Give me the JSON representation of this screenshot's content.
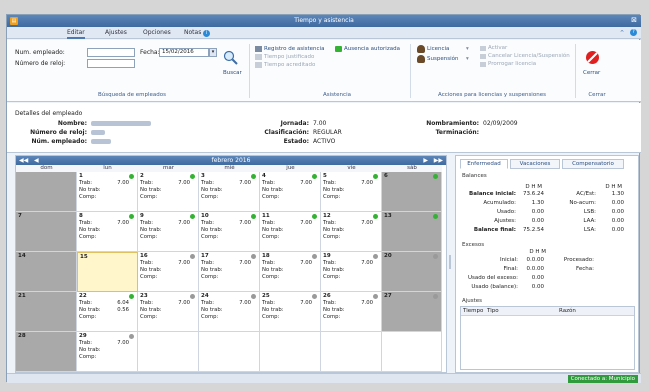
{
  "window": {
    "title": "Tiempo y asistencia",
    "app_icon_glyph": "▤"
  },
  "tabs": [
    "Editar",
    "Ajustes",
    "Opciones",
    "Notas"
  ],
  "search": {
    "emp_label": "Num. empleado:",
    "clock_label": "Número de reloj:",
    "date_label": "Fecha:",
    "date_value": "15/02/2016",
    "button": "Buscar",
    "group": "Búsqueda de empleados"
  },
  "asistencia": {
    "registro": "Registro de asistencia",
    "ausencia": "Ausencia autorizada",
    "justificado": "Tiempo justificado",
    "acreditado": "Tiempo acreditado",
    "group": "Asistencia"
  },
  "licencias": {
    "licencia": "Licencia",
    "suspension": "Suspensión",
    "activar": "Activar",
    "cancelar": "Cancelar Licencia/Suspensión",
    "prorrogar": "Prorrogar licencia",
    "group": "Acciones para licencias y suspensiones"
  },
  "cerrar": {
    "button": "Cerrar",
    "group": "Cerrar"
  },
  "details": {
    "heading": "Detalles del empleado",
    "nombre_label": "Nombre:",
    "reloj_label": "Número de reloj:",
    "num_label": "Núm. empleado:",
    "jornada_label": "Jornada:",
    "jornada_value": "7.00",
    "clasif_label": "Clasificación:",
    "clasif_value": "REGULAR",
    "estado_label": "Estado:",
    "estado_value": "ACTIVO",
    "nombram_label": "Nombramiento:",
    "nombram_value": "02/09/2009",
    "termin_label": "Terminación:",
    "termin_value": ""
  },
  "calendar": {
    "month": "febrero 2016",
    "nav_prev2": "◀◀",
    "nav_prev": "◀",
    "nav_next": "▶",
    "nav_next2": "▶▶",
    "days": [
      "dom",
      "lun",
      "mar",
      "mié",
      "jue",
      "vie",
      "sáb"
    ],
    "labels": {
      "trab": "Trab:",
      "notrab": "No trab:",
      "comp": "Comp:"
    },
    "weeks": [
      [
        {
          "d": "",
          "gray": true
        },
        {
          "d": "1",
          "trab": "7.00",
          "notrab": "",
          "dot": "#34b233"
        },
        {
          "d": "2",
          "trab": "7.00",
          "notrab": "",
          "dot": "#34b233"
        },
        {
          "d": "3",
          "trab": "7.00",
          "notrab": "",
          "dot": "#34b233"
        },
        {
          "d": "4",
          "trab": "7.00",
          "notrab": "",
          "dot": "#34b233"
        },
        {
          "d": "5",
          "trab": "7.00",
          "notrab": "",
          "dot": "#34b233"
        },
        {
          "d": "6",
          "gray": true,
          "dot": "#34b233"
        }
      ],
      [
        {
          "d": "7",
          "gray": true
        },
        {
          "d": "8",
          "trab": "7.00",
          "notrab": "",
          "dot": "#34b233"
        },
        {
          "d": "9",
          "trab": "7.00",
          "notrab": "",
          "dot": "#34b233"
        },
        {
          "d": "10",
          "trab": "7.00",
          "notrab": "",
          "dot": "#34b233"
        },
        {
          "d": "11",
          "trab": "7.00",
          "notrab": "",
          "dot": "#34b233"
        },
        {
          "d": "12",
          "trab": "7.00",
          "notrab": "",
          "dot": "#34b233"
        },
        {
          "d": "13",
          "gray": true,
          "dot": "#34b233"
        }
      ],
      [
        {
          "d": "14",
          "gray": true
        },
        {
          "d": "15",
          "today": true
        },
        {
          "d": "16",
          "trab": "7.00",
          "notrab": "",
          "dot": "#9a9a9a"
        },
        {
          "d": "17",
          "trab": "7.00",
          "notrab": "",
          "dot": "#9a9a9a"
        },
        {
          "d": "18",
          "trab": "7.00",
          "notrab": "",
          "dot": "#9a9a9a"
        },
        {
          "d": "19",
          "trab": "7.00",
          "notrab": "",
          "dot": "#9a9a9a"
        },
        {
          "d": "20",
          "gray": true,
          "dot": "#9a9a9a"
        }
      ],
      [
        {
          "d": "21",
          "gray": true
        },
        {
          "d": "22",
          "trab": "6.04",
          "notrab": "0.56",
          "dot": "#34b233"
        },
        {
          "d": "23",
          "trab": "7.00",
          "notrab": "",
          "dot": "#9a9a9a"
        },
        {
          "d": "24",
          "trab": "7.00",
          "notrab": "",
          "dot": "#9a9a9a"
        },
        {
          "d": "25",
          "trab": "7.00",
          "notrab": "",
          "dot": "#9a9a9a"
        },
        {
          "d": "26",
          "trab": "7.00",
          "notrab": "",
          "dot": "#9a9a9a"
        },
        {
          "d": "27",
          "gray": true,
          "dot": "#9a9a9a"
        }
      ],
      [
        {
          "d": "28",
          "gray": true
        },
        {
          "d": "29",
          "trab": "7.00",
          "notrab": "",
          "dot": "#9a9a9a"
        },
        {
          "d": "",
          "blank": true
        },
        {
          "d": "",
          "blank": true
        },
        {
          "d": "",
          "blank": true
        },
        {
          "d": "",
          "blank": true
        },
        {
          "d": "",
          "blank": true
        }
      ]
    ]
  },
  "right_panel": {
    "tabs": [
      "Enfermedad",
      "Vacaciones",
      "Compensatorio"
    ],
    "balances": {
      "title": "Balances",
      "dhm": "D H M",
      "rows_left": [
        {
          "label": "Balance inicial:",
          "value": "73.6.24",
          "bold": true
        },
        {
          "label": "Acumulado:",
          "value": "1.30"
        },
        {
          "label": "Usado:",
          "value": "0.00"
        },
        {
          "label": "Ajustes:",
          "value": "0.00"
        },
        {
          "label": "Balance final:",
          "value": "75.2.54",
          "bold": true
        }
      ],
      "rows_right": [
        {
          "label": "AC/Est:",
          "value": "1.30"
        },
        {
          "label": "No-acum:",
          "value": "0.00"
        },
        {
          "label": "LSB:",
          "value": "0.00"
        },
        {
          "label": "LAA:",
          "value": "0.00"
        },
        {
          "label": "LSA:",
          "value": "0.00"
        }
      ]
    },
    "excesos": {
      "title": "Excesos",
      "dhm": "D H M",
      "inicial_label": "Inicial:",
      "inicial_value": "0.0.00",
      "final_label": "Final:",
      "final_value": "0.0.00",
      "usado_label": "Usado del exceso:",
      "usado_value": "0.00",
      "usadobal_label": "Usado (balance):",
      "usadobal_value": "0.00",
      "procesado_label": "Procesado:",
      "fecha_label": "Fecha:"
    },
    "ajustes": {
      "title": "Ajustes",
      "columns": [
        "Tiempo",
        "Tipo",
        "Razón"
      ]
    }
  },
  "status": {
    "connection": "Conectado a: Municipio"
  },
  "colors": {
    "accent": "#4c7ab0",
    "green": "#34b233",
    "gray_dot": "#9a9a9a",
    "weekend": "#a9a9a9"
  }
}
